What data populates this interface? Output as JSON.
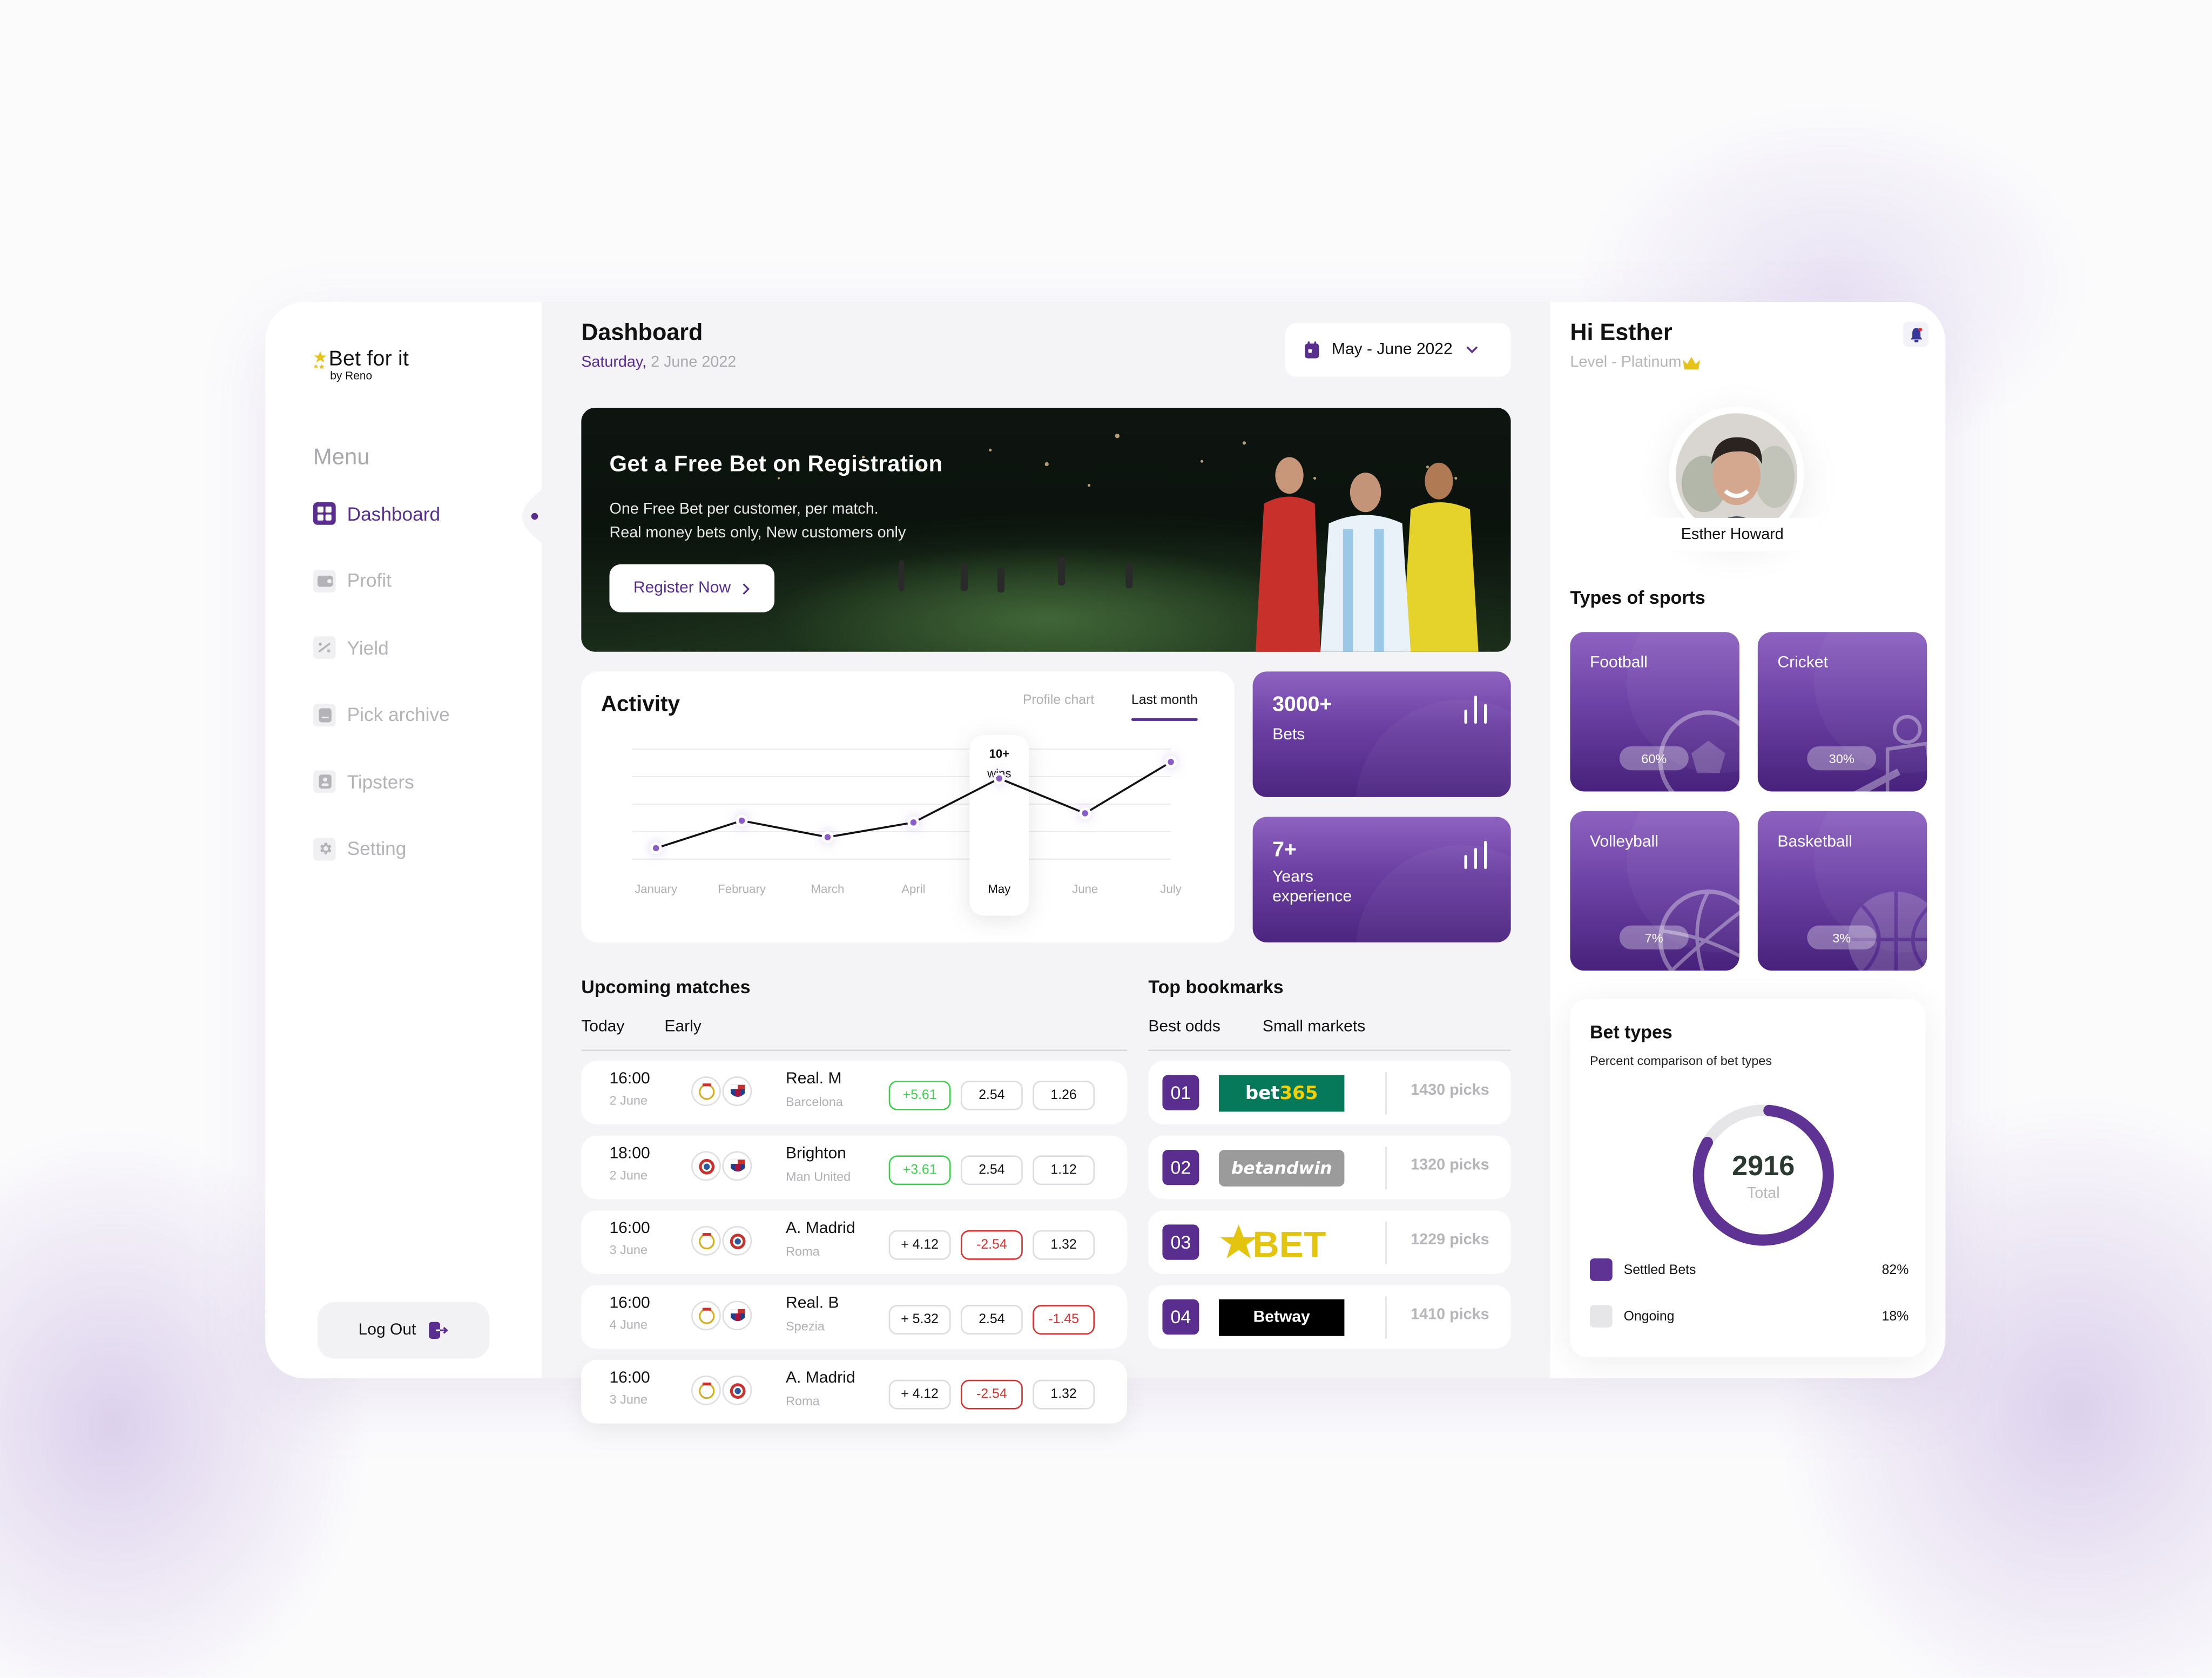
{
  "brand": {
    "name": "Bet for it",
    "tagline": "by Reno"
  },
  "sidebar": {
    "menu_label": "Menu",
    "items": [
      {
        "label": "Dashboard",
        "icon": "grid-icon",
        "active": true
      },
      {
        "label": "Profit",
        "icon": "wallet-icon",
        "active": false
      },
      {
        "label": "Yield",
        "icon": "percent-icon",
        "active": false
      },
      {
        "label": "Pick archive",
        "icon": "document-icon",
        "active": false
      },
      {
        "label": "Tipsters",
        "icon": "user-badge-icon",
        "active": false
      },
      {
        "label": "Setting",
        "icon": "gear-icon",
        "active": false
      }
    ],
    "logout_label": "Log Out"
  },
  "header": {
    "title": "Dashboard",
    "day": "Saturday,",
    "date": " 2 June 2022",
    "range_picker": "May - June 2022"
  },
  "banner": {
    "title": "Get a Free Bet on Registration",
    "line1": "One Free Bet per customer, per match.",
    "line2": "Real money bets only, New customers only",
    "cta": "Register Now"
  },
  "activity": {
    "title": "Activity",
    "tabs": [
      "Profile chart",
      "Last month"
    ],
    "active_tab": "Last month",
    "tooltip_value": "10+",
    "tooltip_label": "wins"
  },
  "chart_data": {
    "type": "line",
    "title": "Activity",
    "categories": [
      "January",
      "February",
      "March",
      "April",
      "May",
      "June",
      "July"
    ],
    "values": [
      0.6,
      2.1,
      1.2,
      2.0,
      4.4,
      2.5,
      5.3
    ],
    "highlighted": "May",
    "ylim": [
      0,
      6
    ],
    "grid": true,
    "yticks_shown": false
  },
  "stats": [
    {
      "value": "3000+",
      "label": "Bets"
    },
    {
      "value": "7+",
      "label": "Years experience"
    }
  ],
  "matches": {
    "title": "Upcoming matches",
    "tabs": [
      "Today",
      "Early"
    ],
    "active_tab": "Today",
    "rows": [
      {
        "time": "16:00",
        "date": "2 June",
        "team": "Real. M",
        "opponent": "Barcelona",
        "badges": [
          "real-madrid-crest",
          "barcelona-crest"
        ],
        "odds": [
          {
            "v": "+5.61",
            "s": "up"
          },
          {
            "v": "2.54",
            "s": ""
          },
          {
            "v": "1.26",
            "s": ""
          }
        ]
      },
      {
        "time": "18:00",
        "date": "2 June",
        "team": "Brighton",
        "opponent": "Man United",
        "badges": [
          "bayern-crest",
          "barcelona-crest"
        ],
        "odds": [
          {
            "v": "+3.61",
            "s": "up"
          },
          {
            "v": "2.54",
            "s": ""
          },
          {
            "v": "1.12",
            "s": ""
          }
        ]
      },
      {
        "time": "16:00",
        "date": "3 June",
        "team": "A. Madrid",
        "opponent": "Roma",
        "badges": [
          "real-madrid-crest",
          "bayern-crest"
        ],
        "odds": [
          {
            "v": "+ 4.12",
            "s": ""
          },
          {
            "v": "-2.54",
            "s": "down"
          },
          {
            "v": "1.32",
            "s": ""
          }
        ]
      },
      {
        "time": "16:00",
        "date": "4 June",
        "team": "Real. B",
        "opponent": "Spezia",
        "badges": [
          "real-madrid-crest",
          "barcelona-crest"
        ],
        "odds": [
          {
            "v": "+ 5.32",
            "s": ""
          },
          {
            "v": "2.54",
            "s": ""
          },
          {
            "v": "-1.45",
            "s": "down"
          }
        ]
      },
      {
        "time": "16:00",
        "date": "3 June",
        "team": "A. Madrid",
        "opponent": "Roma",
        "badges": [
          "real-madrid-crest",
          "bayern-crest"
        ],
        "odds": [
          {
            "v": "+ 4.12",
            "s": ""
          },
          {
            "v": "-2.54",
            "s": "down"
          },
          {
            "v": "1.32",
            "s": ""
          }
        ]
      }
    ]
  },
  "bookmarks": {
    "title": "Top bookmarks",
    "tabs": [
      "Best odds",
      "Small markets"
    ],
    "active_tab": "Best odds",
    "rows": [
      {
        "rank": "01",
        "name": "bet365",
        "picks": "1430 picks"
      },
      {
        "rank": "02",
        "name": "betandwin",
        "picks": "1320 picks"
      },
      {
        "rank": "03",
        "name": "BET",
        "picks": "1229 picks"
      },
      {
        "rank": "04",
        "name": "Betway",
        "picks": "1410 picks"
      }
    ]
  },
  "profile": {
    "greeting": "Hi Esther",
    "level": "Level - Platinum",
    "name": "Esther Howard",
    "has_notification": true
  },
  "sports": {
    "title": "Types of sports",
    "items": [
      {
        "name": "Football",
        "share": "60%"
      },
      {
        "name": "Cricket",
        "share": "30%"
      },
      {
        "name": "Volleyball",
        "share": "7%"
      },
      {
        "name": "Basketball",
        "share": "3%"
      }
    ]
  },
  "bet_types": {
    "title": "Bet types",
    "subtitle": "Percent comparison of bet types",
    "total": "2916",
    "total_label": "Total",
    "segments": [
      {
        "label": "Settled Bets",
        "percent": 82,
        "display": "82%",
        "color": "#5e3393"
      },
      {
        "label": "Ongoing",
        "percent": 18,
        "display": "18%",
        "color": "#e6e6e8"
      }
    ]
  },
  "colors": {
    "accent": "#5a2e8e",
    "positive": "#3ecf4e",
    "negative": "#d93030",
    "gold": "#e7c21a"
  }
}
